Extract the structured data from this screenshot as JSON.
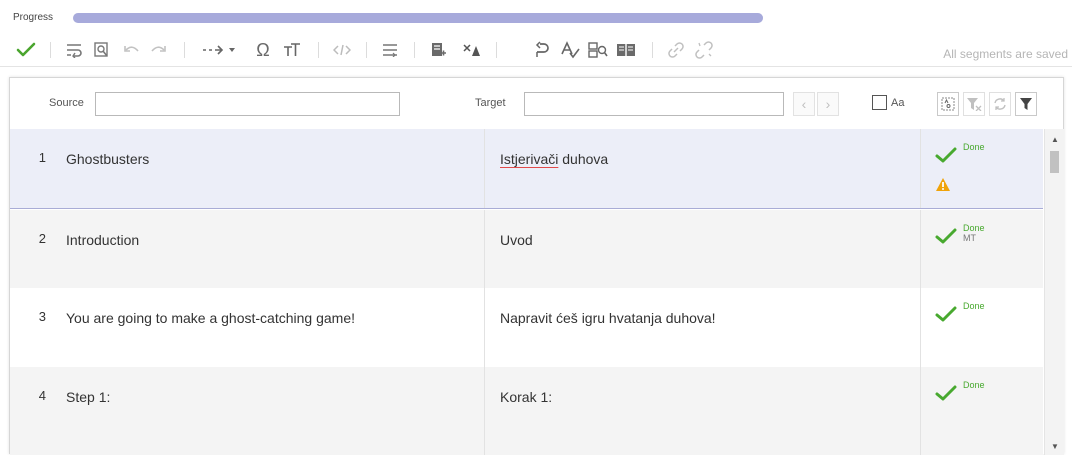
{
  "progress": {
    "label": "Progress",
    "fraction": 1.0
  },
  "toolbar": {
    "status": "All segments are saved",
    "icons": [
      "confirm-check-icon",
      "wrap-text-icon",
      "find-replace-icon",
      "undo-icon",
      "redo-icon",
      "insert-tag-icon",
      "special-char-omega-icon",
      "text-size-icon",
      "code-tags-icon",
      "format-lines-icon",
      "add-note-icon",
      "lqa-icon",
      "revert-icon",
      "spellcheck-icon",
      "concordance-icon",
      "tm-book-icon",
      "link-icon",
      "unlink-icon"
    ]
  },
  "filter": {
    "source_label": "Source",
    "source_value": "",
    "target_label": "Target",
    "target_value": "",
    "match_case_label": "Aa"
  },
  "segments": [
    {
      "num": "1",
      "source": "Ghostbusters",
      "target_word1": "Istjerivači",
      "target_rest": " duhova",
      "status": "Done",
      "mt": "",
      "warning": true
    },
    {
      "num": "2",
      "source": "Introduction",
      "target_word1": "Uvod",
      "target_rest": "",
      "status": "Done",
      "mt": "MT",
      "warning": false
    },
    {
      "num": "3",
      "source": "You are going to make a ghost-catching game!",
      "target_word1": "Napravit ćeš igru hvatanja duhova!",
      "target_rest": "",
      "status": "Done",
      "mt": "",
      "warning": false
    },
    {
      "num": "4",
      "source": "Step 1:",
      "target_word1": "Korak 1:",
      "target_rest": "",
      "status": "Done",
      "mt": "",
      "warning": false
    }
  ],
  "colors": {
    "accent": "#a7aadb",
    "done_green": "#48a92f",
    "warning_orange": "#f0a30a",
    "active_row": "#eceef8"
  }
}
